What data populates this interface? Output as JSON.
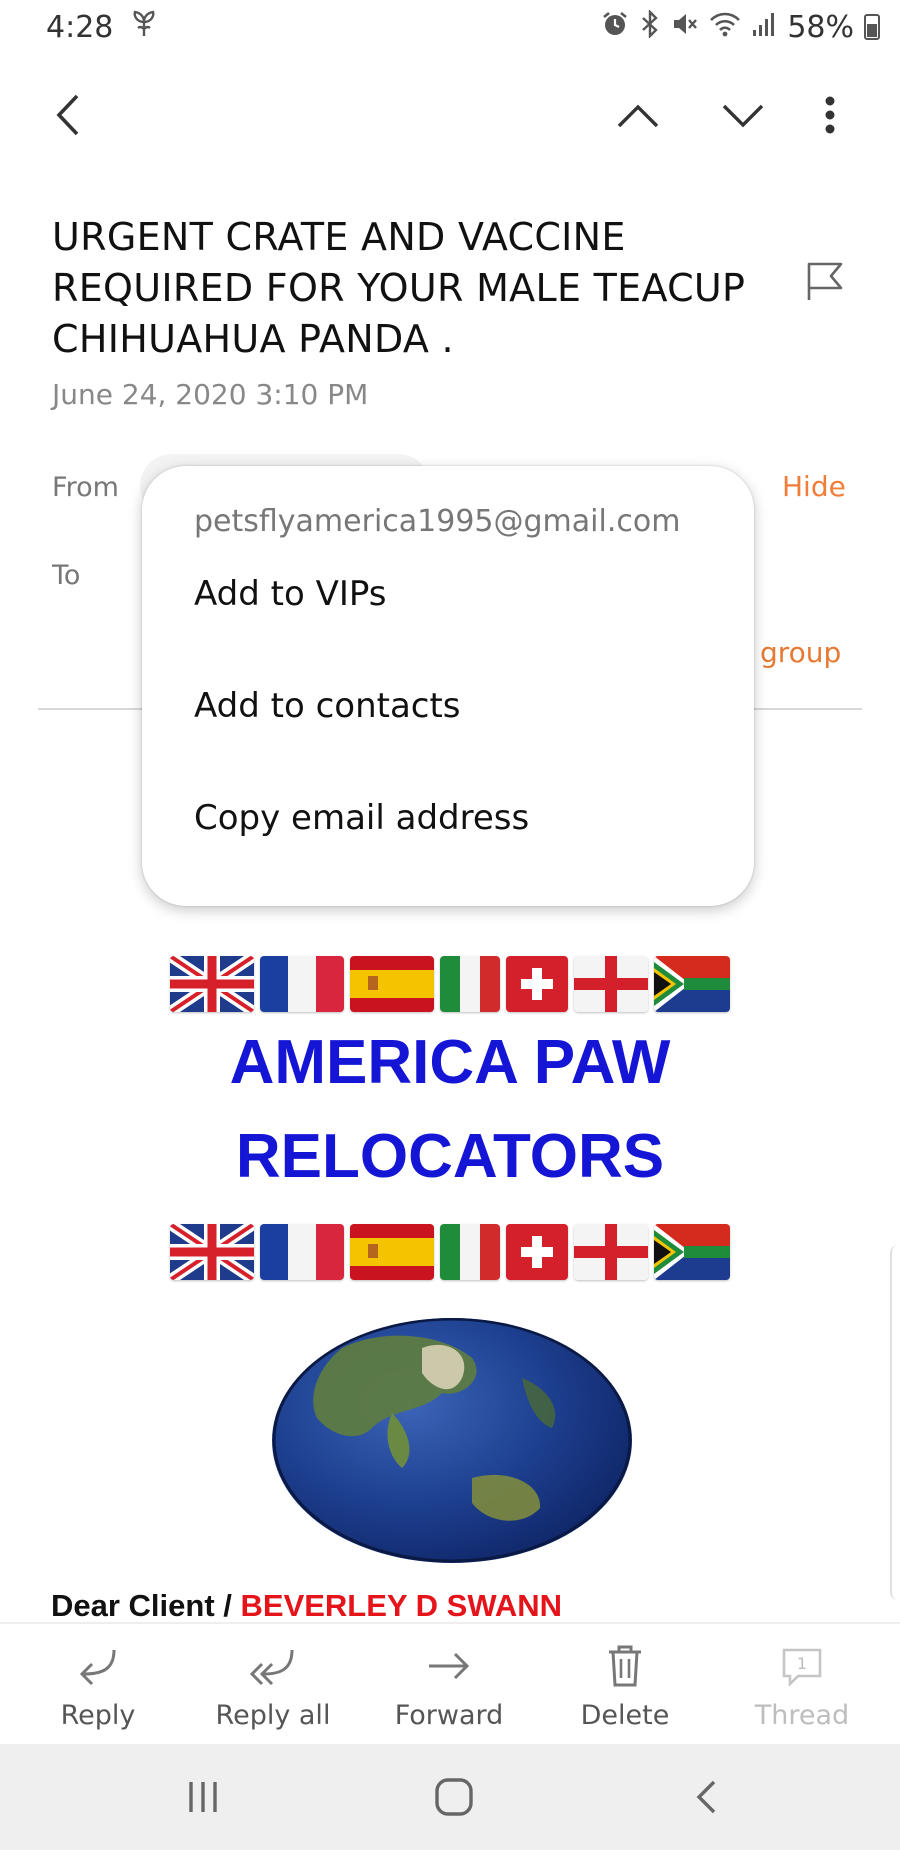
{
  "status_bar": {
    "time": "4:28",
    "battery": "58%",
    "icons": [
      "plant-notification-icon",
      "alarm-icon",
      "bluetooth-icon",
      "mute-icon",
      "wifi-icon",
      "signal-icon",
      "battery-icon"
    ]
  },
  "app_bar": {
    "icons": [
      "back-arrow-icon",
      "previous-email-icon",
      "next-email-icon",
      "more-options-icon"
    ]
  },
  "email": {
    "subject": "URGENT CRATE AND VACCINE REQUIRED FOR YOUR MALE TEACUP CHIHUAHUA PANDA .",
    "date": "June 24, 2020  3:10 PM",
    "from_label": "From",
    "to_label": "To",
    "hide_label": "Hide",
    "group_label": "group"
  },
  "popup_menu": {
    "email_address": "petsflyamerica1995@gmail.com",
    "items": [
      "Add to VIPs",
      "Add to contacts",
      "Copy email address"
    ]
  },
  "body": {
    "cut_heading": "RELOCATORS",
    "company_line1": "AMERICA PAW",
    "company_line2": "RELOCATORS",
    "flags": [
      "uk",
      "france",
      "spain",
      "italy",
      "switzerland",
      "england",
      "south-africa"
    ],
    "greeting_prefix": "Dear Client / ",
    "client_name": "BEVERLEY D SWANN"
  },
  "toolbar": {
    "reply": "Reply",
    "reply_all": "Reply all",
    "forward": "Forward",
    "delete": "Delete",
    "thread": "Thread",
    "thread_count": "1"
  },
  "colors": {
    "accent_orange": "#ef7e3a",
    "heading_blue": "#1515d6",
    "client_red": "#e5141b"
  }
}
